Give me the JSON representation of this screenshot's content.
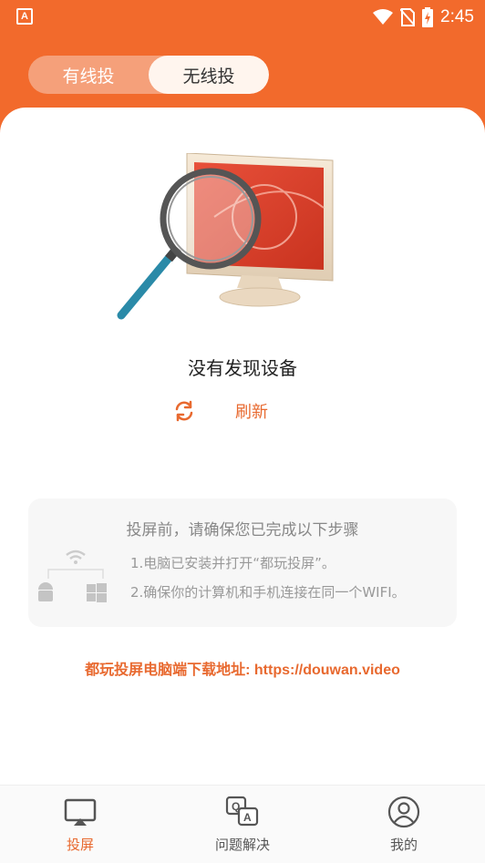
{
  "status_bar": {
    "time": "2:45",
    "left_icon": "A",
    "icons": [
      "wifi-icon",
      "no-sim-icon",
      "battery-charging-icon"
    ]
  },
  "segment": {
    "wired_label": "有线投",
    "wireless_label": "无线投",
    "active": "wireless"
  },
  "empty_state": {
    "message": "没有发现设备",
    "refresh_label": "刷新"
  },
  "instructions": {
    "title": "投屏前，请确保您已完成以下步骤",
    "step1": "1.电脑已安装并打开“都玩投屏”。",
    "step2": "2.确保你的计算机和手机连接在同一个WIFI。"
  },
  "download_text": "都玩投屏电脑端下载地址: https://douwan.video",
  "bottom_nav": {
    "items": [
      {
        "label": "投屏",
        "icon": "cast-icon",
        "active": true
      },
      {
        "label": "问题解决",
        "icon": "qa-icon",
        "active": false
      },
      {
        "label": "我的",
        "icon": "profile-icon",
        "active": false
      }
    ]
  },
  "colors": {
    "brand": "#f26a2c",
    "accent_text": "#e8692f"
  }
}
